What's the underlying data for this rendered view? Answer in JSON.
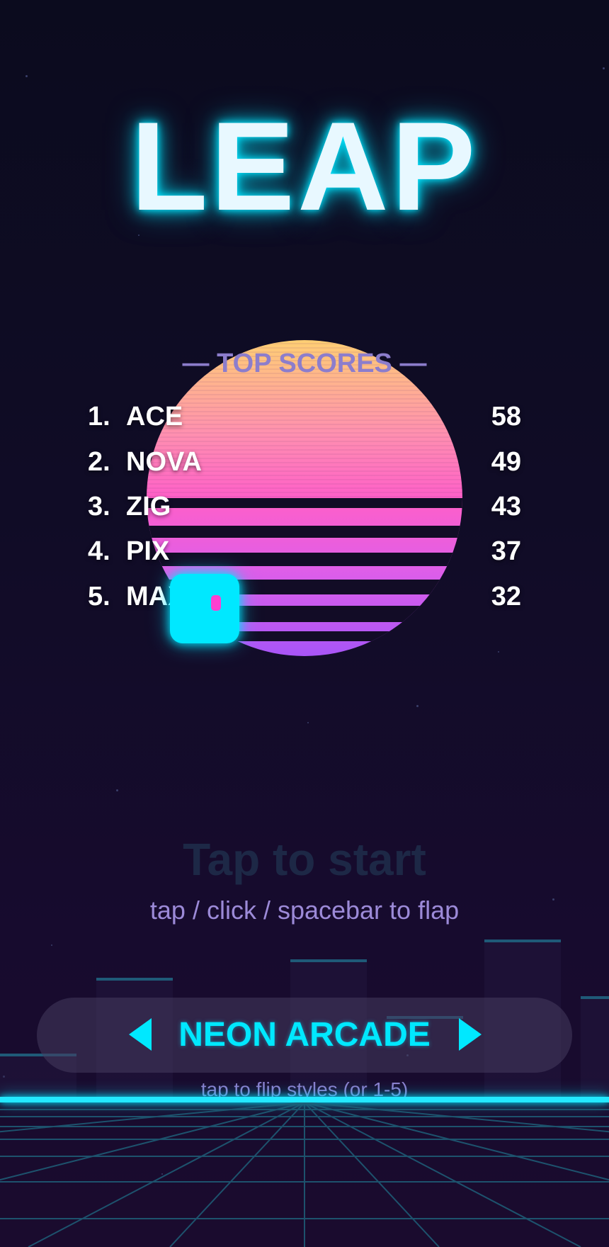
{
  "game": {
    "title": "LEAP",
    "scores_title": "— TOP SCORES —",
    "scores": [
      {
        "rank": "1.",
        "name": "ACE",
        "score": "58"
      },
      {
        "rank": "2.",
        "name": "NOVA",
        "score": "49"
      },
      {
        "rank": "3.",
        "name": "ZIG",
        "score": "43"
      },
      {
        "rank": "4.",
        "name": "PIX",
        "score": "37"
      },
      {
        "rank": "5.",
        "name": "MAX",
        "score": "32"
      }
    ],
    "tap_to_start": "Tap to start",
    "control_hint": "tap / click / spacebar to flap",
    "style_selector": {
      "current_style": "NEON ARCADE",
      "hint": "tap to flip styles  (or 1-5)",
      "prev_icon": "triangle-left-icon",
      "next_icon": "triangle-right-icon"
    }
  },
  "colors": {
    "background": "#100c26",
    "neon_cyan": "#00e8ff",
    "sun_top": "#ffcf73",
    "sun_mid": "#ff5fc8",
    "sun_bottom": "#a855f7",
    "muted_purple": "#8c7dcc",
    "bird_eye": "#ff3fd0"
  }
}
